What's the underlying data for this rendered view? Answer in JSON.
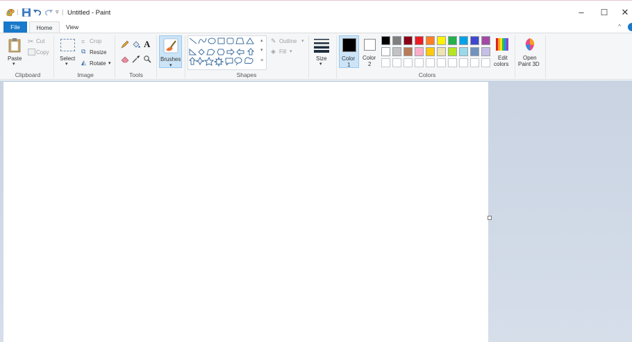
{
  "window": {
    "title": "Untitled - Paint",
    "controls": {
      "minimize": "–",
      "maximize": "☐",
      "close": "✕"
    }
  },
  "quick_access": {
    "separator": "|",
    "dropdown": "▿"
  },
  "tabs": {
    "file": "File",
    "home": "Home",
    "view": "View"
  },
  "ribbon": {
    "collapse": "^",
    "clipboard": {
      "label": "Clipboard",
      "paste": "Paste",
      "cut": "Cut",
      "copy": "Copy"
    },
    "image": {
      "label": "Image",
      "select": "Select",
      "crop": "Crop",
      "resize": "Resize",
      "rotate": "Rotate"
    },
    "tools": {
      "label": "Tools"
    },
    "brushes": {
      "label": "Brushes"
    },
    "shapes": {
      "label": "Shapes",
      "outline": "Outline",
      "fill": "Fill"
    },
    "size": {
      "label": "Size"
    },
    "colors": {
      "label": "Colors",
      "color1_line1": "Color",
      "color1_line2": "1",
      "color2_line1": "Color",
      "color2_line2": "2",
      "edit_line1": "Edit",
      "edit_line2": "colors",
      "paint3d_line1": "Open",
      "paint3d_line2": "Paint 3D",
      "color1_value": "#000000",
      "color2_value": "#ffffff",
      "palette_row1": [
        "#000000",
        "#7f7f7f",
        "#880015",
        "#ed1c24",
        "#ff7f27",
        "#fff200",
        "#22b14c",
        "#00a2e8",
        "#3f48cc",
        "#a349a4"
      ],
      "palette_row2": [
        "#ffffff",
        "#c3c3c3",
        "#b97a57",
        "#ffaec9",
        "#ffc90e",
        "#efe4b0",
        "#b5e61d",
        "#99d9ea",
        "#7092be",
        "#c8bfe7"
      ],
      "palette_row3": [
        "#ffffff",
        "#ffffff",
        "#ffffff",
        "#ffffff",
        "#ffffff",
        "#ffffff",
        "#ffffff",
        "#ffffff",
        "#ffffff",
        "#ffffff"
      ]
    }
  }
}
